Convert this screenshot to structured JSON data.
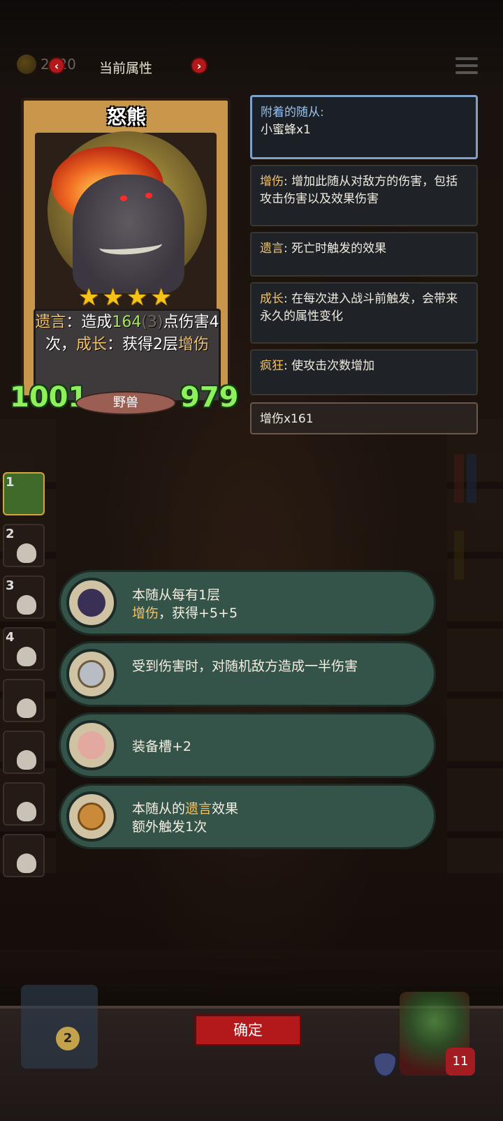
{
  "topbar": {
    "coins": "2020",
    "title": "当前属性",
    "prev_arrow": "‹",
    "next_arrow": "›"
  },
  "card": {
    "name": "怒熊",
    "stars": "★★★★",
    "desc": {
      "kw1": "遗言",
      "part1": "：造成",
      "dmg": "164",
      "dmg_extra": "(3)",
      "part2": "点伤害4次，",
      "kw2": "成长",
      "part3": "：获得2层",
      "kw3": "增伤"
    },
    "attack": "1001",
    "health": "979",
    "type": "野兽"
  },
  "panel": {
    "attached_label": "附着的随从:",
    "attached_value": "小蜜蜂x1",
    "entries": [
      {
        "kw": "增伤",
        "text": ": 增加此随从对敌方的伤害，包括攻击伤害以及效果伤害"
      },
      {
        "kw": "遗言",
        "text": ": 死亡时触发的效果"
      },
      {
        "kw": "成长",
        "text": ": 在每次进入战斗前触发，会带来永久的属性变化"
      },
      {
        "kw": "疯狂",
        "text": ": 使攻击次数增加"
      }
    ],
    "buff_summary": "增伤x161"
  },
  "slots": [
    "1",
    "2",
    "3",
    "4",
    "",
    "",
    "",
    ""
  ],
  "items": [
    {
      "line1": "本随从每有1层",
      "kw": "增伤",
      "line2_rest": "，获得+5+5",
      "icon": "bat-icon"
    },
    {
      "line1": "受到伤害时，对随机敌方造成一半伤害",
      "icon": "mirror-icon"
    },
    {
      "line1": "装备槽+2",
      "icon": "pig-icon"
    },
    {
      "line1_pre": "本随从的",
      "kw": "遗言",
      "line1_post": "效果",
      "line2": "额外触发1次",
      "icon": "coin-icon"
    }
  ],
  "footer": {
    "confirm_label": "确定",
    "deck_count": "2",
    "hero_health": "11"
  },
  "colors": {
    "keyword": "#f2c26b",
    "stat_green": "#8ef05a",
    "button_red": "#b3181b",
    "item_bg": "#345349"
  }
}
